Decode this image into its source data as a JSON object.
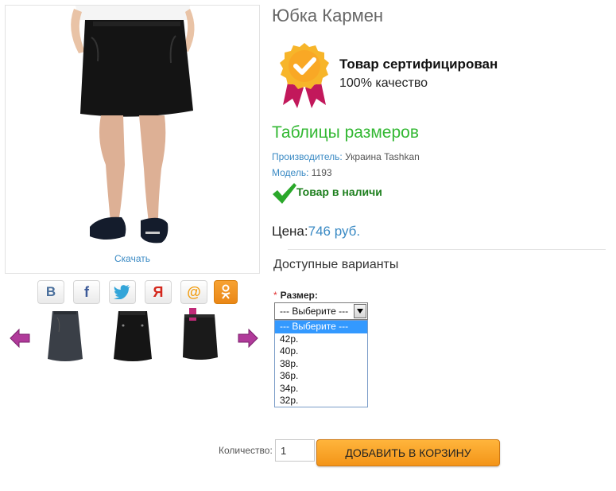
{
  "product": {
    "title": "Юбка Кармен",
    "download_label": "Скачать"
  },
  "certificate": {
    "title": "Товар сертифицирован",
    "subtitle": "100% качество"
  },
  "size_tables_link": "Таблицы размеров",
  "details": {
    "manufacturer_label": "Производитель:",
    "manufacturer_value": " Украина Tashkan",
    "model_label": "Модель:",
    "model_value": " 1193"
  },
  "stock_status": "Товар в наличи",
  "price": {
    "label": "Цена:",
    "value": "746 руб."
  },
  "variants": {
    "title": "Доступные варианты",
    "size_label": "Размер:",
    "required_mark": "*",
    "selected": "--- Выберите ---",
    "options": [
      "--- Выберите ---",
      "42р.",
      "40р.",
      "38р.",
      "36р.",
      "34р.",
      "32р."
    ]
  },
  "quantity": {
    "label": "Количество:",
    "value": "1"
  },
  "add_to_cart_label": "ДОБАВИТЬ В КОРЗИНУ",
  "social_icons": [
    "vk-icon",
    "facebook-icon",
    "twitter-icon",
    "odnoklassniki-share-icon",
    "mail-ru-icon",
    "odnoklassniki-icon"
  ],
  "colors": {
    "link_blue": "#3a8ac4",
    "green_link": "#33b833",
    "stock_green": "#1d7f1d",
    "cart_orange": "#f39418",
    "arrow_magenta": "#b03a9a"
  }
}
